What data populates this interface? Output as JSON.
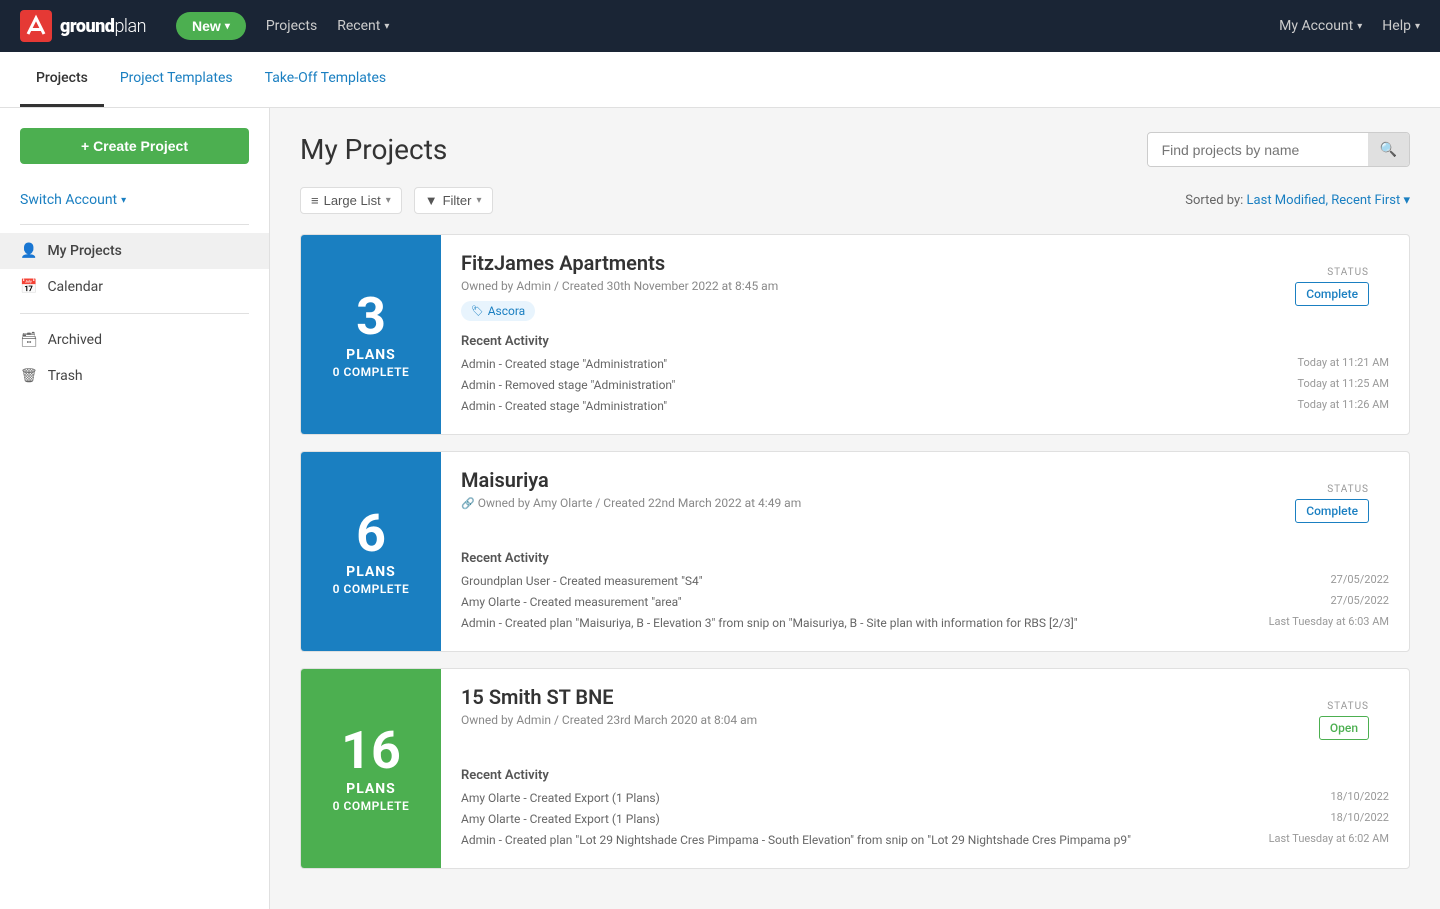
{
  "nav": {
    "logo_bold": "ground",
    "logo_light": "plan",
    "new_label": "New",
    "projects_label": "Projects",
    "recent_label": "Recent",
    "my_account_label": "My Account",
    "help_label": "Help"
  },
  "sub_nav": {
    "tabs": [
      {
        "label": "Projects",
        "active": true
      },
      {
        "label": "Project Templates",
        "active": false
      },
      {
        "label": "Take-Off Templates",
        "active": false
      }
    ]
  },
  "sidebar": {
    "create_btn": "+ Create Project",
    "switch_account": "Switch Account",
    "my_projects": "My Projects",
    "calendar": "Calendar",
    "archived": "Archived",
    "trash": "Trash"
  },
  "content": {
    "page_title": "My Projects",
    "search_placeholder": "Find projects by name",
    "search_btn": "🔍",
    "toolbar": {
      "large_list": "Large List",
      "filter": "Filter",
      "sort_label": "Sorted by:",
      "sort_value": "Last Modified, Recent First"
    },
    "projects": [
      {
        "thumb_number": "3",
        "thumb_plans": "PLANS",
        "thumb_complete": "0 COMPLETE",
        "thumb_color": "#1a7fc1",
        "name": "FitzJames Apartments",
        "meta": "Owned by Admin / Created 30th November 2022 at 8:45 am",
        "meta_icon": false,
        "tag": "Ascora",
        "status": "Complete",
        "status_type": "complete",
        "activities": [
          {
            "text": "Admin - Created stage \"Administration\"",
            "time": "Today at 11:21 AM"
          },
          {
            "text": "Admin - Removed stage \"Administration\"",
            "time": "Today at 11:25 AM"
          },
          {
            "text": "Admin - Created stage \"Administration\"",
            "time": "Today at 11:26 AM"
          }
        ]
      },
      {
        "thumb_number": "6",
        "thumb_plans": "PLANS",
        "thumb_complete": "0 COMPLETE",
        "thumb_color": "#1a7fc1",
        "name": "Maisuriya",
        "meta": "Owned by Amy Olarte / Created 22nd March 2022 at 4:49 am",
        "meta_icon": true,
        "tag": null,
        "status": "Complete",
        "status_type": "complete",
        "activities": [
          {
            "text": "Groundplan User - Created measurement \"S4\"",
            "time": "27/05/2022"
          },
          {
            "text": "Amy Olarte - Created measurement \"area\"",
            "time": "27/05/2022"
          },
          {
            "text": "Admin - Created plan \"Maisuriya, B - Elevation 3\" from snip on \"Maisuriya, B - Site plan with information for RBS [2/3]\"",
            "time": "Last Tuesday at 6:03 AM"
          }
        ]
      },
      {
        "thumb_number": "16",
        "thumb_plans": "PLANS",
        "thumb_complete": "0 COMPLETE",
        "thumb_color": "#4caf50",
        "name": "15 Smith ST BNE",
        "meta": "Owned by Admin / Created 23rd March 2020 at 8:04 am",
        "meta_icon": false,
        "tag": null,
        "status": "Open",
        "status_type": "open",
        "activities": [
          {
            "text": "Amy Olarte - Created Export (1 Plans)",
            "time": "18/10/2022"
          },
          {
            "text": "Amy Olarte - Created Export (1 Plans)",
            "time": "18/10/2022"
          },
          {
            "text": "Admin - Created plan \"Lot 29 Nightshade Cres Pimpama - South Elevation\" from snip on \"Lot 29 Nightshade Cres Pimpama p9\"",
            "time": "Last Tuesday at 6:02 AM"
          }
        ]
      }
    ]
  }
}
